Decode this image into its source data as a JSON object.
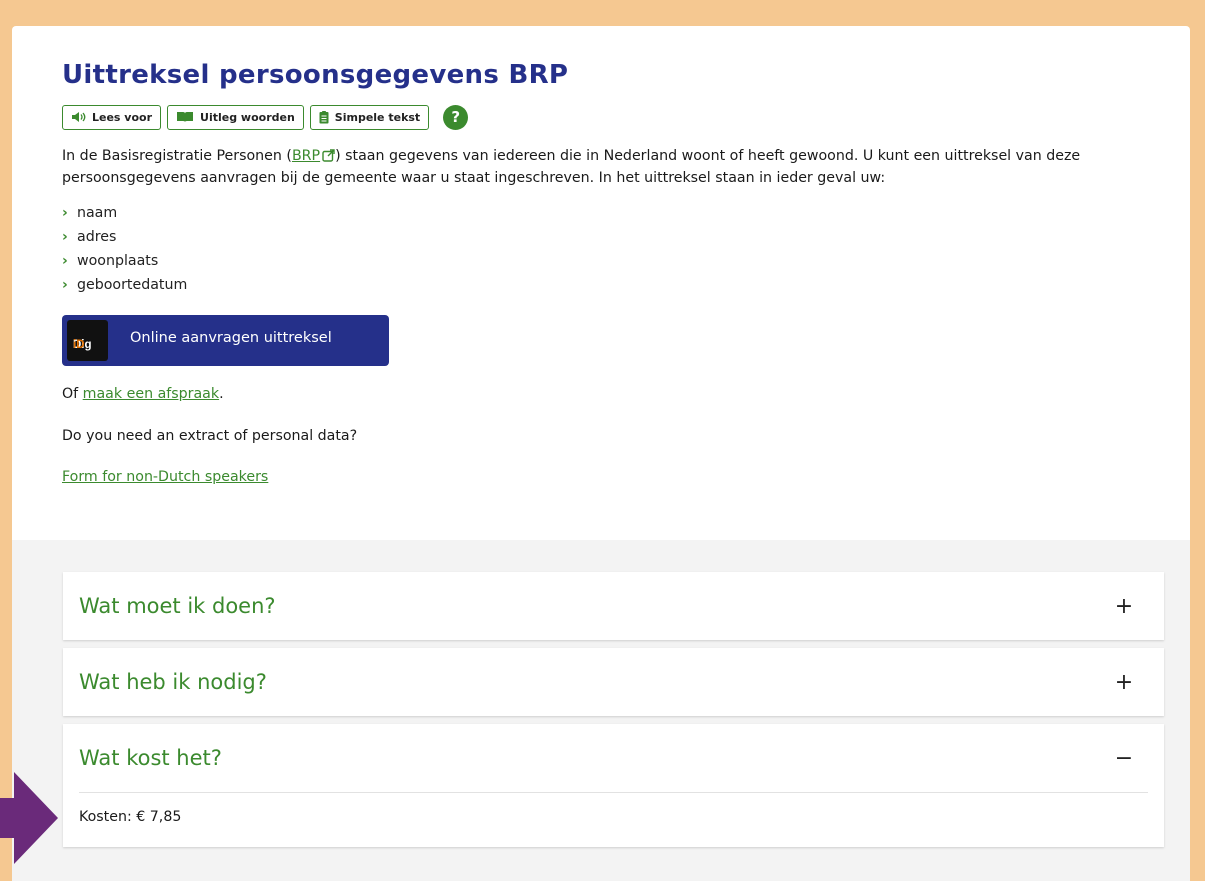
{
  "page": {
    "title": "Uittreksel persoonsgegevens BRP"
  },
  "tools": {
    "read_aloud": "Lees voor",
    "explain_words": "Uitleg woorden",
    "simple_text": "Simpele tekst",
    "help": "?"
  },
  "intro": {
    "part1": "In de Basisregistratie Personen (",
    "link": "BRP",
    "part2": ") staan gegevens van iedereen die in Nederland woont of heeft gewoond. U kunt een uittreksel van deze persoonsgegevens aanvragen bij de gemeente waar u staat ingeschreven. In het uittreksel staan in ieder geval uw:"
  },
  "list": [
    "naam",
    "adres",
    "woonplaats",
    "geboortedatum"
  ],
  "digid": {
    "logo_dig": "Dig",
    "logo_id": "iD",
    "label": "Online aanvragen uittreksel"
  },
  "appointment": {
    "prefix": "Of ",
    "link": "maak een afspraak",
    "suffix": "."
  },
  "english": {
    "question": "Do you need an extract of personal data?",
    "form_link": "Form for non-Dutch speakers"
  },
  "accordion": [
    {
      "title": "Wat moet ik doen?",
      "toggle": "+"
    },
    {
      "title": "Wat heb ik nodig?",
      "toggle": "+"
    },
    {
      "title": "Wat kost het?",
      "toggle": "−",
      "body": "Kosten: € 7,85"
    }
  ],
  "colors": {
    "frame": "#f5c891",
    "title": "#25308a",
    "accent_green": "#3b8a2e",
    "arrow": "#6a2a7a",
    "digid_orange": "#e17000"
  }
}
